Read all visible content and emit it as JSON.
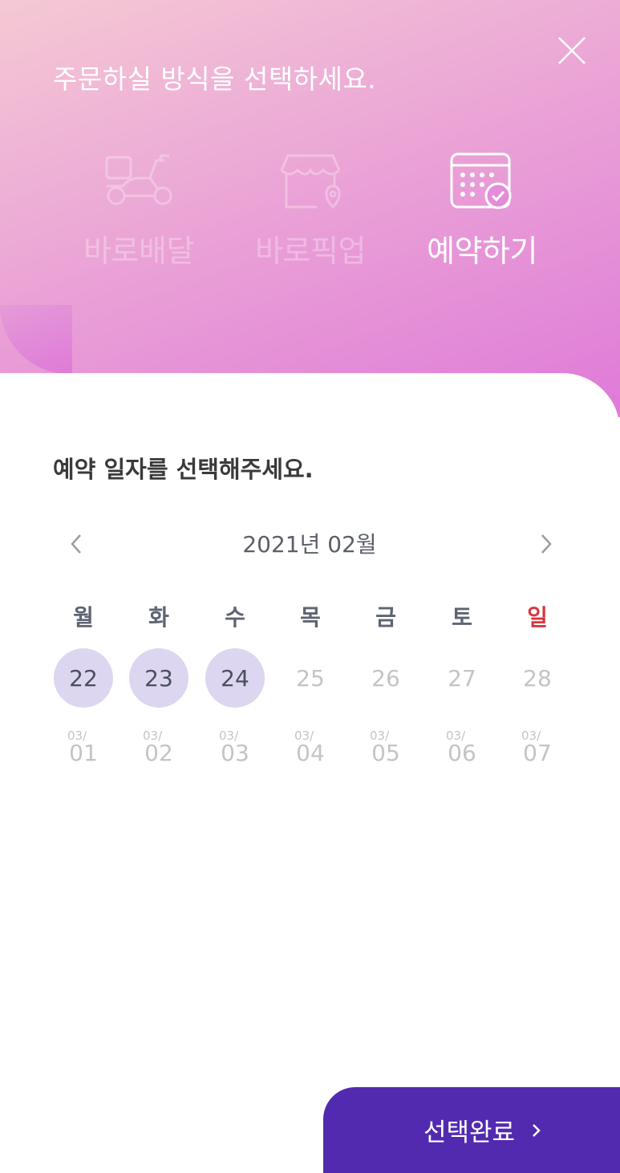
{
  "header": {
    "title": "주문하실 방식을 선택하세요.",
    "close_icon": "close-icon"
  },
  "modes": [
    {
      "label": "바로배달",
      "icon": "scooter-icon",
      "active": false
    },
    {
      "label": "바로픽업",
      "icon": "store-icon",
      "active": false
    },
    {
      "label": "예약하기",
      "icon": "calendar-check-icon",
      "active": true
    }
  ],
  "calendar": {
    "section_title": "예약 일자를 선택해주세요.",
    "month_label": "2021년 02월",
    "weekdays": [
      "월",
      "화",
      "수",
      "목",
      "금",
      "토",
      "일"
    ],
    "week1": [
      {
        "day": "22",
        "selectable": true
      },
      {
        "day": "23",
        "selectable": true
      },
      {
        "day": "24",
        "selectable": true
      },
      {
        "day": "25",
        "selectable": false
      },
      {
        "day": "26",
        "selectable": false
      },
      {
        "day": "27",
        "selectable": false
      },
      {
        "day": "28",
        "selectable": false
      }
    ],
    "week2": [
      {
        "month": "03/",
        "day": "01"
      },
      {
        "month": "03/",
        "day": "02"
      },
      {
        "month": "03/",
        "day": "03"
      },
      {
        "month": "03/",
        "day": "04"
      },
      {
        "month": "03/",
        "day": "05"
      },
      {
        "month": "03/",
        "day": "06"
      },
      {
        "month": "03/",
        "day": "07"
      }
    ]
  },
  "footer": {
    "confirm_label": "선택완료"
  },
  "colors": {
    "accent": "#522ab0",
    "selectable_bg": "#ddd6f0",
    "sunday": "#d9363e"
  }
}
